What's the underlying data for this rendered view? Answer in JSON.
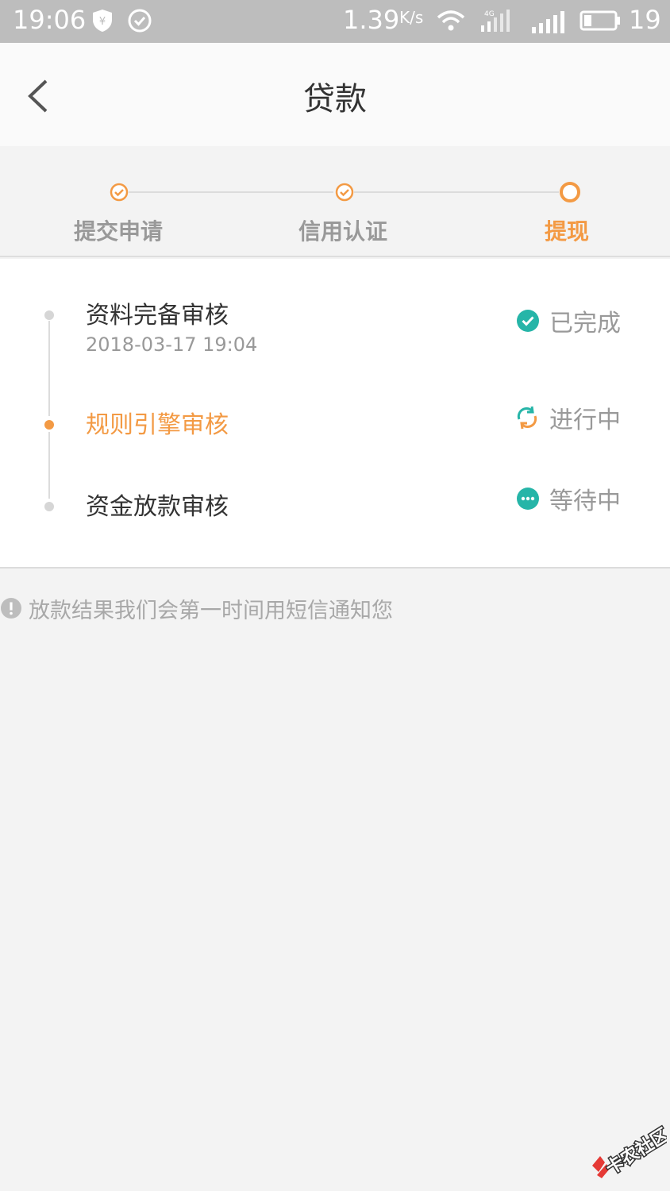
{
  "status_bar": {
    "time": "19:06",
    "speed": "1.39",
    "speed_unit": "K/s",
    "battery": "19"
  },
  "header": {
    "title": "贷款"
  },
  "steps": [
    {
      "label": "提交申请",
      "state": "done"
    },
    {
      "label": "信用认证",
      "state": "done"
    },
    {
      "label": "提现",
      "state": "active"
    }
  ],
  "timeline": [
    {
      "title": "资料完备审核",
      "date": "2018-03-17 19:04",
      "status": "已完成",
      "state": "done"
    },
    {
      "title": "规则引擎审核",
      "date": "",
      "status": "进行中",
      "state": "active"
    },
    {
      "title": "资金放款审核",
      "date": "",
      "status": "等待中",
      "state": "waiting"
    }
  ],
  "notice": "放款结果我们会第一时间用短信通知您",
  "watermark": {
    "text": "卡农社区"
  },
  "colors": {
    "accent": "#f39a44",
    "teal": "#26b5a8",
    "muted": "#999999"
  }
}
